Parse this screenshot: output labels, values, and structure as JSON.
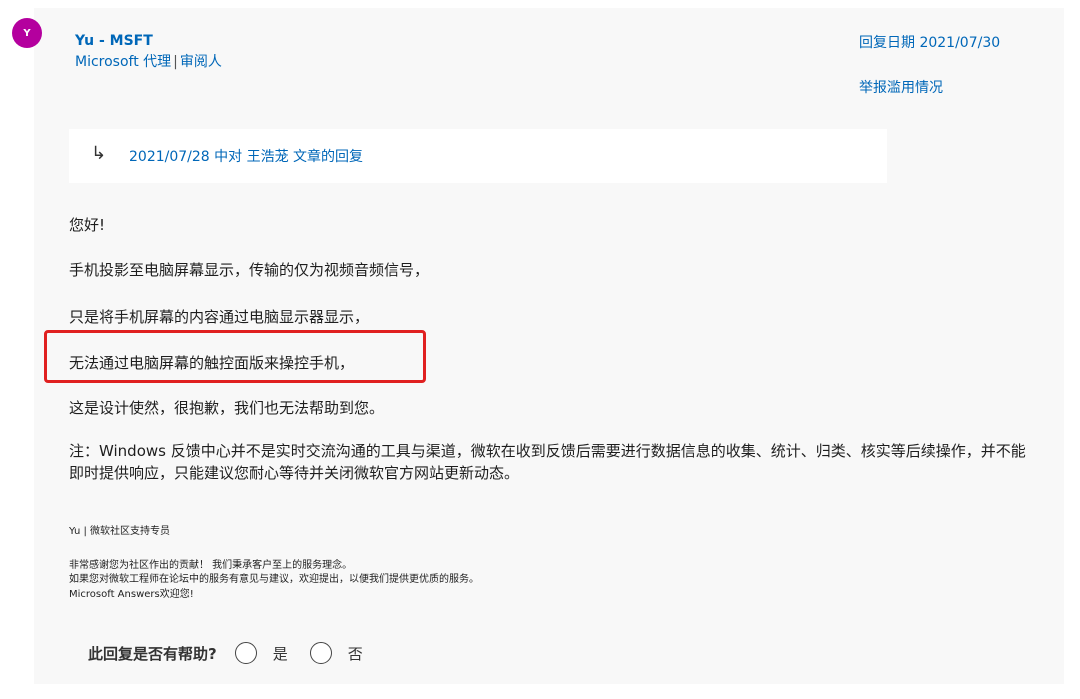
{
  "author": {
    "avatar_letter": "Y",
    "name": "Yu - MSFT",
    "role": "Microsoft 代理",
    "separator": "|",
    "role2": "审阅人"
  },
  "meta": {
    "reply_date": "回复日期 2021/07/30",
    "report_abuse": "举报滥用情况"
  },
  "quote": {
    "arrow": "↳",
    "text": "2021/07/28 中对 王浩茏 文章的回复"
  },
  "body": {
    "greeting": "您好!",
    "line1": "手机投影至电脑屏幕显示，传输的仅为视频音频信号，",
    "line2": "只是将手机屏幕的内容通过电脑显示器显示，",
    "line3": "无法通过电脑屏幕的触控面版来操控手机，",
    "line4": "这是设计使然，很抱歉，我们也无法帮助到您。",
    "note": "注：Windows 反馈中心并不是实时交流沟通的工具与渠道，微软在收到反馈后需要进行数据信息的收集、统计、归类、核实等后续操作，并不能即时提供响应，只能建议您耐心等待并关闭微软官方网站更新动态。"
  },
  "signature": {
    "name": "Yu | 微软社区支持专员",
    "line1": "非常感谢您为社区作出的贡献！ 我们秉承客户至上的服务理念。",
    "line2": "如果您对微软工程师在论坛中的服务有意见与建议，欢迎提出，以便我们提供更优质的服务。",
    "line3": "Microsoft Answers欢迎您!"
  },
  "helpful": {
    "question": "此回复是否有帮助?",
    "yes": "是",
    "no": "否"
  },
  "colors": {
    "link": "#0067b8",
    "avatar": "#b4009e",
    "highlight": "#e02020"
  }
}
